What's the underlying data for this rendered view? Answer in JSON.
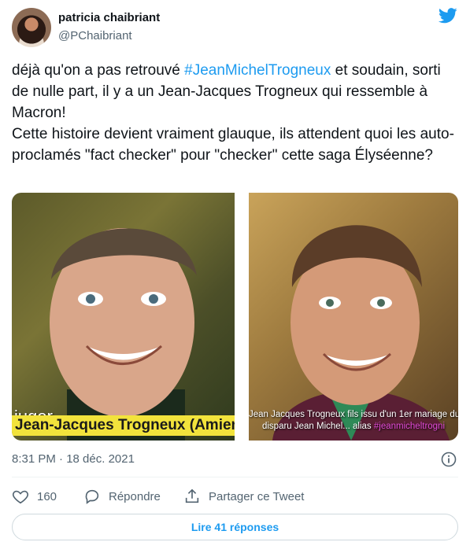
{
  "author": {
    "name": "patricia chaibriant",
    "handle": "@PChaibriant",
    "avatar_icon": "avatar"
  },
  "brand_icon": "twitter-bird-icon",
  "brand_color": "#1d9bf0",
  "tweet": {
    "line1_before": "déjà qu'on a pas retrouvé ",
    "hashtag": "#JeanMichelTrogneux",
    "line1_after": " et soudain, sorti de nulle part, il y a un Jean-Jacques Trogneux qui ressemble à Macron!\nCette histoire devient vraiment glauque, ils attendent quoi les auto-proclamés \"fact checker\" pour \"checker\" cette saga Élyséenne?"
  },
  "media": {
    "left_overlay": "juger",
    "left_caption": "Jean-Jacques Trogneux (Amien",
    "right_caption_line1": "Jean Jacques Trogneux fils issu d'un 1er mariage du",
    "right_caption_line2_text": "disparu Jean Michel... alias ",
    "right_caption_line2_tag": "#jeanmicheltrogni"
  },
  "timestamp": "8:31 PM · 18 déc. 2021",
  "actions": {
    "like_count": "160",
    "reply_label": "Répondre",
    "share_label": "Partager ce Tweet"
  },
  "read_replies": "Lire 41 réponses"
}
